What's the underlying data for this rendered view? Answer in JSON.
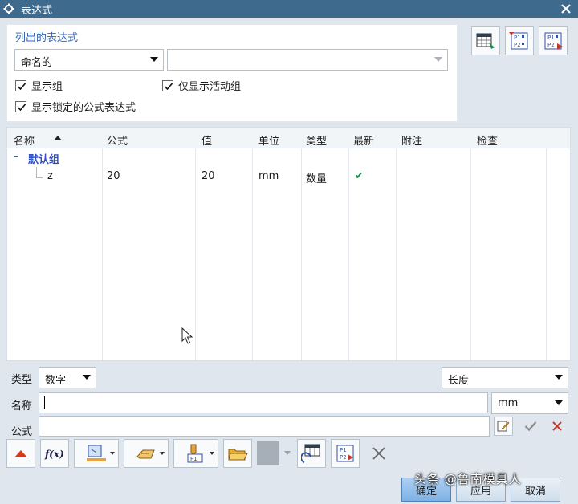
{
  "window": {
    "title": "表达式"
  },
  "filter": {
    "section_title": "列出的表达式",
    "list_mode": "命名的",
    "filter_text": "",
    "show_groups": "显示组",
    "show_active_group_only": "仅显示活动组",
    "show_locked_formula": "显示锁定的公式表达式"
  },
  "table": {
    "columns": [
      "名称",
      "公式",
      "值",
      "单位",
      "类型",
      "最新",
      "附注",
      "检查"
    ],
    "group": {
      "toggle": "–",
      "name": "默认组"
    },
    "rows": [
      {
        "name": "z",
        "formula": "20",
        "value": "20",
        "unit": "mm",
        "type": "数量",
        "uptodate": "✔"
      }
    ]
  },
  "editor": {
    "type_label": "类型",
    "type_value": "数字",
    "dimension_value": "长度",
    "name_label": "名称",
    "name_value": "",
    "unit_value": "mm",
    "formula_label": "公式",
    "formula_value": ""
  },
  "buttons": {
    "ok": "确定",
    "apply": "应用",
    "cancel": "取消"
  },
  "watermark": "头条 @鲁南模具人",
  "colors": {
    "titlebar": "#3e6a8e",
    "section_title": "#2f62b4",
    "check_green": "#1f8a4c"
  }
}
